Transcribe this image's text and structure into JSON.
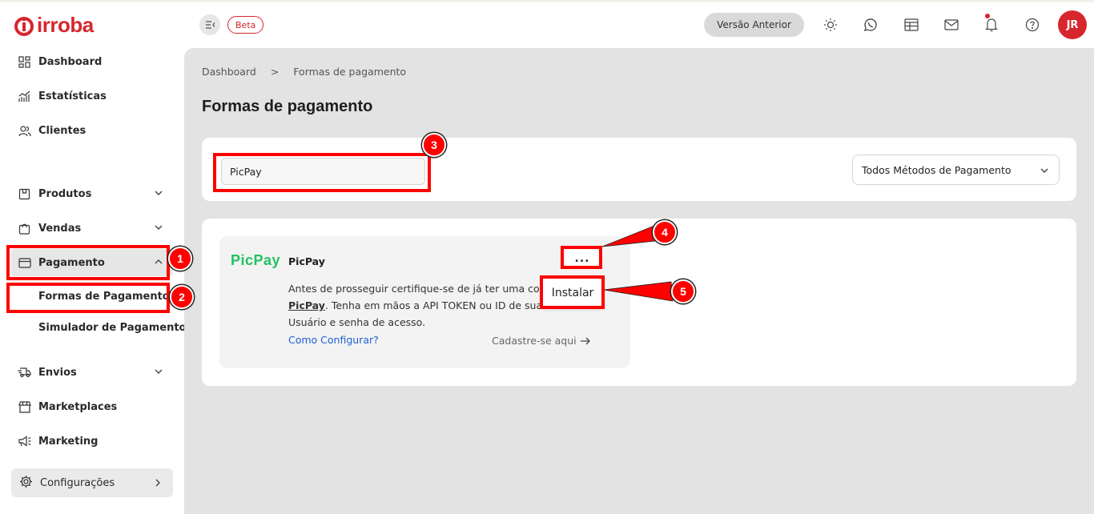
{
  "brand": {
    "logo_text": "irroba",
    "accent": "#d7262e"
  },
  "topbar": {
    "beta_label": "Beta",
    "previous_version_label": "Versão Anterior",
    "avatar_initials": "JR"
  },
  "sidebar": {
    "items": [
      {
        "label": "Dashboard",
        "icon": "grid-icon"
      },
      {
        "label": "Estatísticas",
        "icon": "chart-icon"
      },
      {
        "label": "Clientes",
        "icon": "users-icon"
      },
      {
        "label": "Produtos",
        "icon": "box-icon"
      },
      {
        "label": "Vendas",
        "icon": "bag-icon"
      },
      {
        "label": "Pagamento",
        "icon": "card-icon"
      },
      {
        "label": "Envios",
        "icon": "truck-icon"
      },
      {
        "label": "Marketplaces",
        "icon": "store-icon"
      },
      {
        "label": "Marketing",
        "icon": "megaphone-icon"
      }
    ],
    "sub_items": [
      {
        "label": "Formas de Pagamento"
      },
      {
        "label": "Simulador de Pagamento"
      }
    ],
    "settings_label": "Configurações"
  },
  "breadcrumb": {
    "root": "Dashboard",
    "separator": ">",
    "current": "Formas de pagamento"
  },
  "page": {
    "title": "Formas de pagamento"
  },
  "filters": {
    "search_value": "PicPay",
    "method_select": "Todos Métodos de Pagamento"
  },
  "payment_method": {
    "logo_text": "PicPay",
    "name": "PicPay",
    "menu_dots": "...",
    "desc_before": "Antes de prosseguir certifique-se de já ter uma co",
    "desc_brand": "PicPay",
    "desc_after": ". Tenha em mãos a API TOKEN ou ID de sua",
    "desc_line3": "Usuário e senha de acesso.",
    "config_link": "Como Configurar?",
    "signup_link": "Cadastre-se aqui",
    "install_option": "Instalar",
    "logo_color": "#21c25e"
  },
  "annotations": [
    "1",
    "2",
    "3",
    "4",
    "5"
  ]
}
